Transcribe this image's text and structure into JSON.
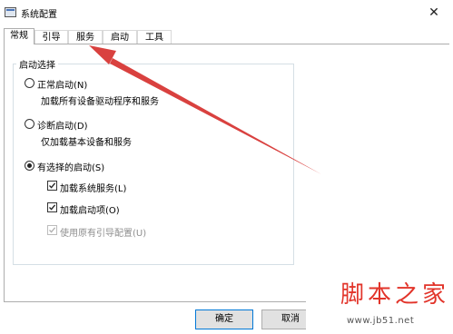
{
  "window": {
    "title": "系统配置",
    "close_glyph": "✕"
  },
  "tabs": [
    {
      "label": "常规",
      "active": true
    },
    {
      "label": "引导",
      "active": false
    },
    {
      "label": "服务",
      "active": false
    },
    {
      "label": "启动",
      "active": false
    },
    {
      "label": "工具",
      "active": false
    }
  ],
  "startup_selection": {
    "legend": "启动选择",
    "normal": {
      "label": "正常启动(N)",
      "desc": "加载所有设备驱动程序和服务",
      "selected": false
    },
    "diagnostic": {
      "label": "诊断启动(D)",
      "desc": "仅加载基本设备和服务",
      "selected": false
    },
    "selective": {
      "label": "有选择的启动(S)",
      "selected": true
    },
    "load_system_services": {
      "label": "加载系统服务(L)",
      "checked": true,
      "enabled": true
    },
    "load_startup_items": {
      "label": "加载启动项(O)",
      "checked": true,
      "enabled": true
    },
    "use_original_boot": {
      "label": "使用原有引导配置(U)",
      "checked": true,
      "enabled": false
    }
  },
  "buttons": {
    "ok": "确定",
    "cancel": "取消"
  },
  "annotation": {
    "arrow_color": "#d9413f"
  },
  "watermark": {
    "title": "脚本之家",
    "url": "www.jb51.net",
    "color": "#e2342a"
  }
}
